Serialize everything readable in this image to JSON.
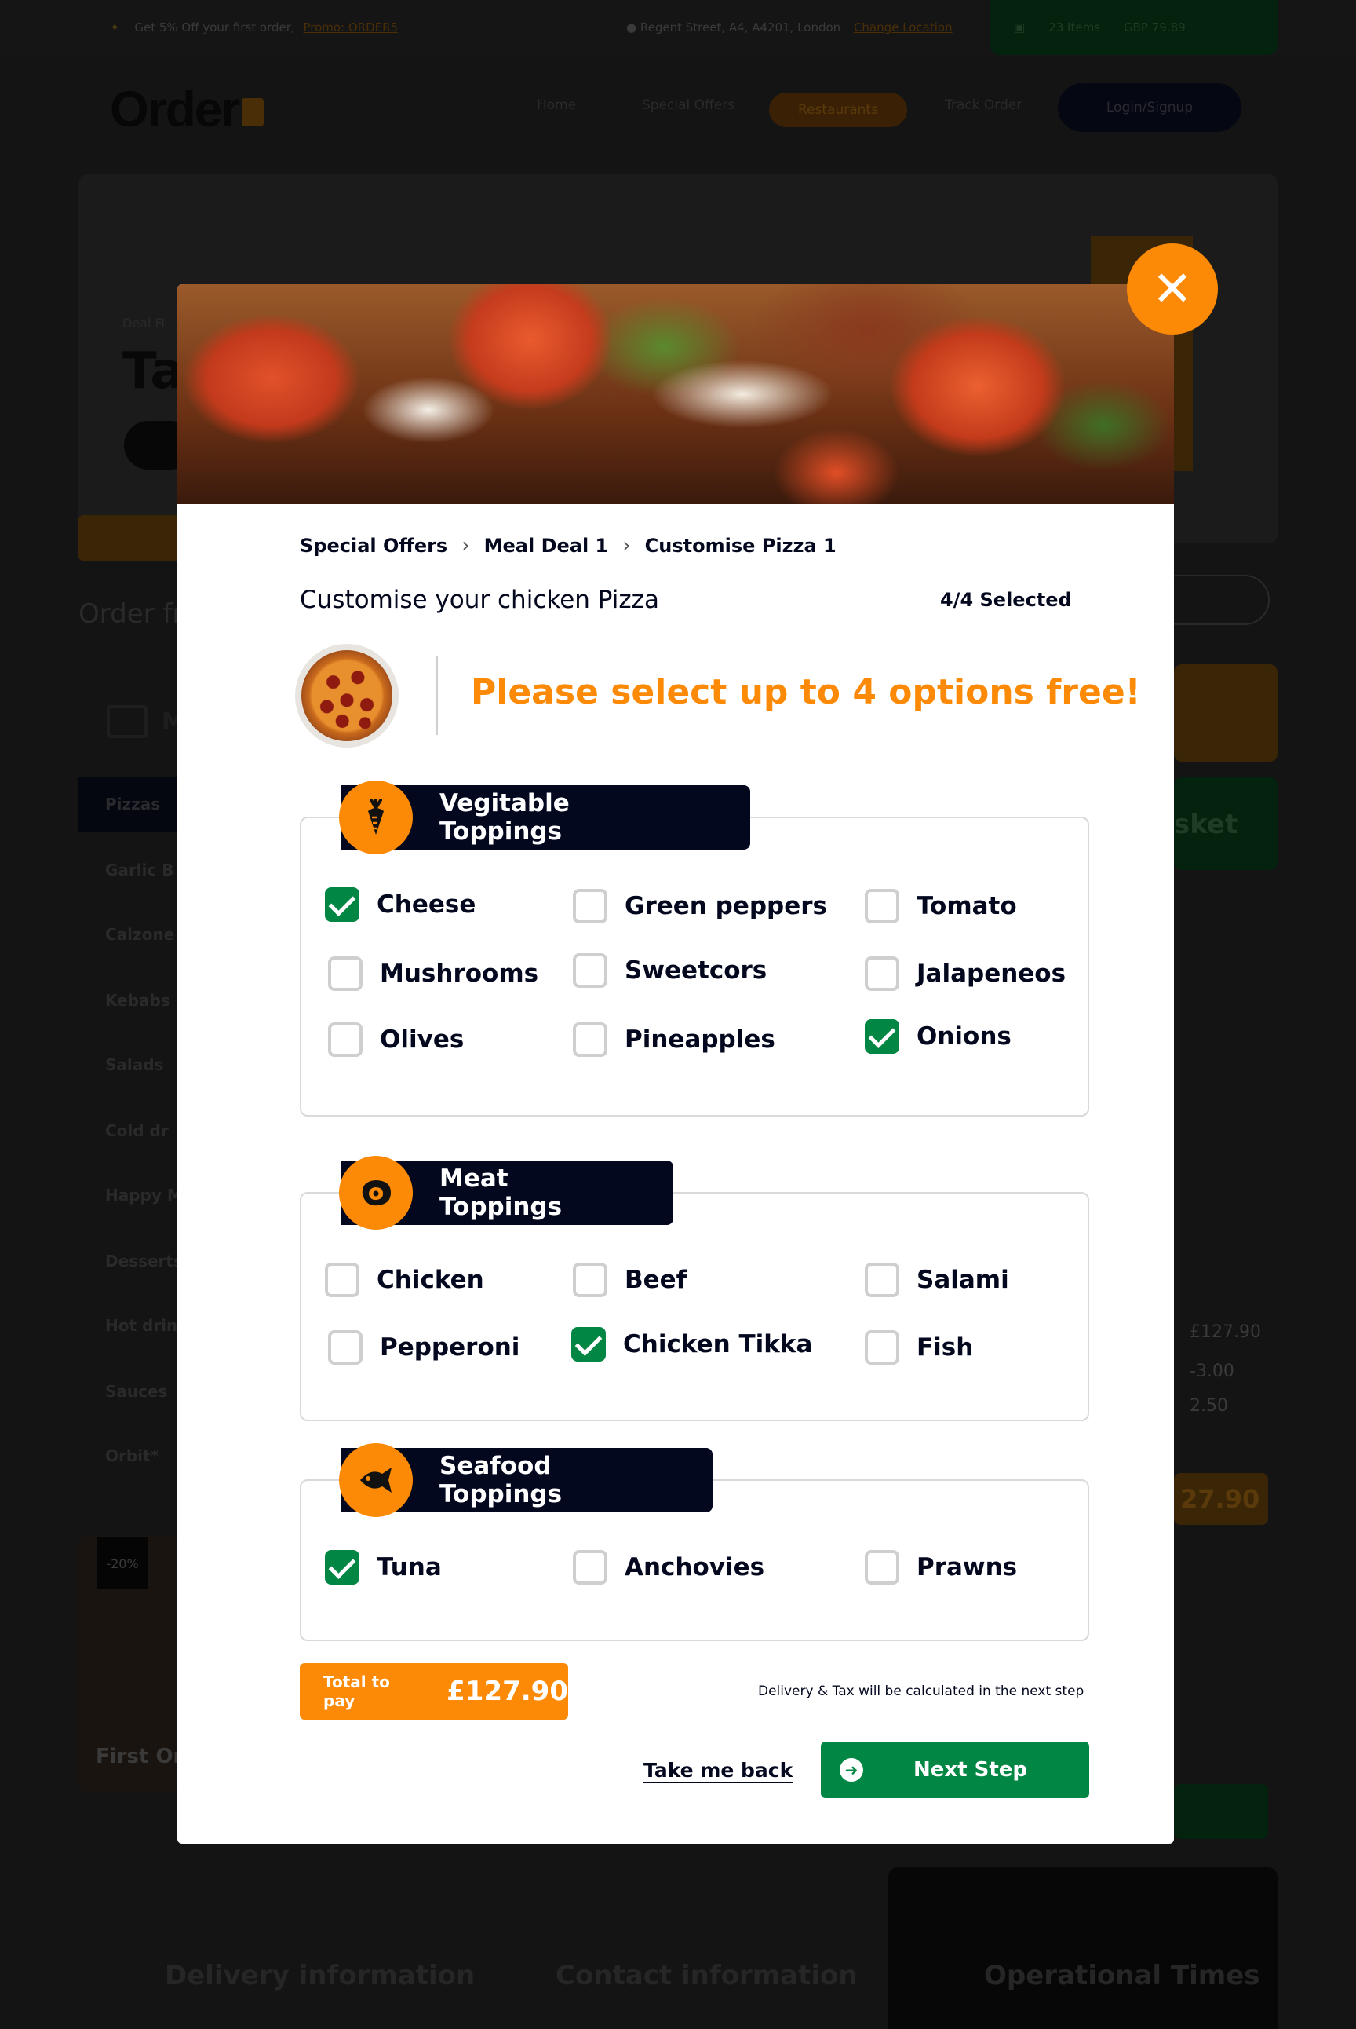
{
  "background": {
    "promo_text": "Get 5% Off your first order,",
    "promo_link": "Promo: ORDER5",
    "location": "Regent Street, A4, A4201, London",
    "location_link": "Change Location",
    "basket_items": "23 Items",
    "basket_total": "GBP 79.89",
    "logo": "Order",
    "nav": {
      "home": "Home",
      "special_offers": "Special Offers",
      "restaurants": "Restaurants",
      "track_order": "Track Order",
      "login": "Login/Signup"
    },
    "hero_small": "Deal Fi",
    "hero_title": "Ta",
    "order_from": "Order fr",
    "menu_label": "M",
    "categories": [
      "Pizzas",
      "Garlic B",
      "Calzone",
      "Kebabs",
      "Salads",
      "Cold dr",
      "Happy M",
      "Desserts",
      "Hot drin",
      "Sauces",
      "Orbit*"
    ],
    "offer_tag": "-20%",
    "offer_text": "First Ord",
    "right_basket": "sket",
    "right_nums": [
      "£127.90",
      "-3.00",
      "2.50"
    ],
    "right_price": "27.90",
    "footer": {
      "delivery": "Delivery information",
      "contact": "Contact information",
      "times": "Operational Times"
    }
  },
  "modal": {
    "close_symbol": "✕",
    "breadcrumb": [
      "Special Offers",
      "Meal Deal 1",
      "Customise Pizza 1"
    ],
    "title": "Customise your chicken Pizza",
    "selected_count": "4/4 Selected",
    "promo_message": "Please select up to 4 options free!",
    "sections": {
      "veg": {
        "title": "Vegitable Toppings",
        "icon": "carrot-icon",
        "options": [
          {
            "label": "Cheese",
            "checked": true
          },
          {
            "label": "Green peppers",
            "checked": false
          },
          {
            "label": "Tomato",
            "checked": false
          },
          {
            "label": "Mushrooms",
            "checked": false
          },
          {
            "label": "Sweetcors",
            "checked": false
          },
          {
            "label": "Jalapeneos",
            "checked": false
          },
          {
            "label": "Olives",
            "checked": false
          },
          {
            "label": "Pineapples",
            "checked": false
          },
          {
            "label": "Onions",
            "checked": true
          }
        ]
      },
      "meat": {
        "title": "Meat Toppings",
        "icon": "steak-icon",
        "options": [
          {
            "label": "Chicken",
            "checked": false
          },
          {
            "label": "Beef",
            "checked": false
          },
          {
            "label": "Salami",
            "checked": false
          },
          {
            "label": "Pepperoni",
            "checked": false
          },
          {
            "label": "Chicken Tikka",
            "checked": true
          },
          {
            "label": "Fish",
            "checked": false
          }
        ]
      },
      "seafood": {
        "title": "Seafood Toppings",
        "icon": "fish-icon",
        "options": [
          {
            "label": "Tuna",
            "checked": true
          },
          {
            "label": "Anchovies",
            "checked": false
          },
          {
            "label": "Prawns",
            "checked": false
          }
        ]
      }
    },
    "total_label": "Total to pay",
    "total_value": "£127.90",
    "delivery_note": "Delivery & Tax will be calculated in the next step",
    "back_label": "Take me back",
    "next_label": "Next Step",
    "colors": {
      "accent": "#fc8a06",
      "green": "#028643",
      "navy": "#03081f"
    }
  }
}
